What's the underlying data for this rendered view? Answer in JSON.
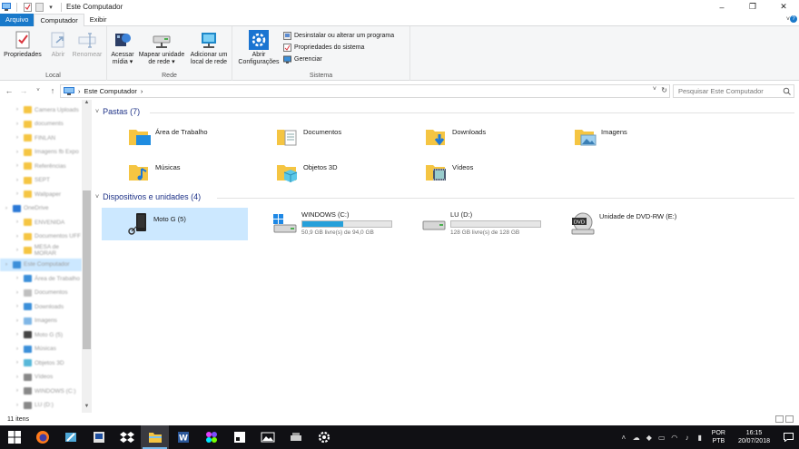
{
  "window": {
    "title": "Este Computador",
    "controls": {
      "minimize": "–",
      "maximize": "❐",
      "close": "✕"
    }
  },
  "ribbon_tabs": [
    "Arquivo",
    "Computador",
    "Exibir"
  ],
  "ribbon": {
    "local": {
      "label": "Local",
      "buttons": [
        "Propriedades",
        "Abrir",
        "Renomear"
      ]
    },
    "rede": {
      "label": "Rede",
      "buttons": [
        {
          "line1": "Acessar",
          "line2": "mídia ▾"
        },
        {
          "line1": "Mapear unidade",
          "line2": "de rede ▾"
        },
        {
          "line1": "Adicionar um",
          "line2": "local de rede"
        }
      ]
    },
    "sistema": {
      "label": "Sistema",
      "big_button": {
        "line1": "Abrir",
        "line2": "Configurações"
      },
      "small_buttons": [
        "Desinstalar ou alterar um programa",
        "Propriedades do sistema",
        "Gerenciar"
      ]
    }
  },
  "address": {
    "path": "Este Computador",
    "separator": "›",
    "search_placeholder": "Pesquisar Este Computador"
  },
  "nav_pane": {
    "items": [
      {
        "label": "Camera Uploads",
        "color": "#f5c542",
        "sel": false
      },
      {
        "label": "documents",
        "color": "#f5c542",
        "sel": false
      },
      {
        "label": "FINLAN",
        "color": "#f5c542",
        "sel": false
      },
      {
        "label": "Imagens fb Expo",
        "color": "#f5c542",
        "sel": false
      },
      {
        "label": "Referências",
        "color": "#f5c542",
        "sel": false
      },
      {
        "label": "SEPT",
        "color": "#f5c542",
        "sel": false
      },
      {
        "label": "Wallpaper",
        "color": "#f5c542",
        "sel": false
      },
      {
        "label": "OneDrive",
        "color": "#2a78d6",
        "sel": false
      },
      {
        "label": "ENVENIDA",
        "color": "#f5c542",
        "sel": false
      },
      {
        "label": "Documentos UFF",
        "color": "#f5c542",
        "sel": false
      },
      {
        "label": "MESA de MORAR",
        "color": "#f5c542",
        "sel": false
      },
      {
        "label": "Este Computador",
        "color": "#3b8fd9",
        "sel": true
      },
      {
        "label": "Área de Trabalho",
        "color": "#3b8fd9",
        "sel": false
      },
      {
        "label": "Documentos",
        "color": "#bfbfbf",
        "sel": false
      },
      {
        "label": "Downloads",
        "color": "#3b8fd9",
        "sel": false
      },
      {
        "label": "Imagens",
        "color": "#7fb6e6",
        "sel": false
      },
      {
        "label": "Moto G (5)",
        "color": "#444",
        "sel": false
      },
      {
        "label": "Músicas",
        "color": "#3b8fd9",
        "sel": false
      },
      {
        "label": "Objetos 3D",
        "color": "#57b8d9",
        "sel": false
      },
      {
        "label": "Vídeos",
        "color": "#888",
        "sel": false
      },
      {
        "label": "WINDOWS (C:)",
        "color": "#888",
        "sel": false
      },
      {
        "label": "LU (D:)",
        "color": "#888",
        "sel": false
      }
    ]
  },
  "sections": {
    "folders_title": "Pastas (7)",
    "devices_title": "Dispositivos e unidades (4)"
  },
  "folders": [
    "Área de Trabalho",
    "Documentos",
    "Downloads",
    "Imagens",
    "Músicas",
    "Objetos 3D",
    "Vídeos"
  ],
  "devices": [
    {
      "name": "Moto G (5)",
      "type": "phone"
    },
    {
      "name": "WINDOWS (C:)",
      "type": "os-drive",
      "free": "50,9 GB livre(s) de 94,0 GB",
      "used_percent": 46
    },
    {
      "name": "LU (D:)",
      "type": "drive",
      "free": "128 GB livre(s) de 128 GB",
      "used_percent": 0
    },
    {
      "name": "Unidade de DVD-RW (E:)",
      "type": "dvd"
    }
  ],
  "status": {
    "items": "11 itens"
  },
  "taskbar": {
    "apps": [
      "windows-start",
      "firefox",
      "notepad-pen",
      "app-blue",
      "dropbox",
      "file-explorer",
      "word",
      "app-purple",
      "sticky",
      "photos",
      "drive-app",
      "settings"
    ],
    "active": "file-explorer",
    "lang": {
      "line1": "POR",
      "line2": "PTB"
    },
    "clock": {
      "time": "16:15",
      "date": "20/07/2018"
    }
  },
  "colors": {
    "accent": "#1979ca",
    "selection": "#cce8ff",
    "taskbar": "#101014",
    "drive_bar": "#26a0da"
  }
}
